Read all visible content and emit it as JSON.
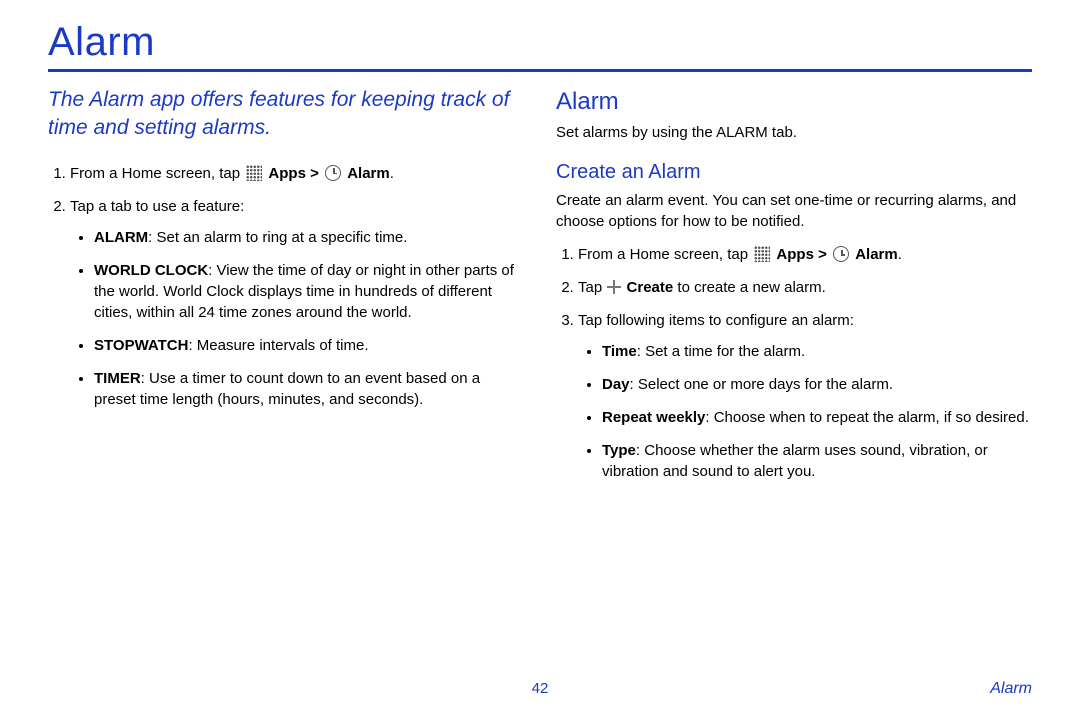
{
  "title": "Alarm",
  "intro": "The Alarm app offers features for keeping track of time and setting alarms.",
  "left": {
    "step1_pre": "From a Home screen, tap ",
    "step1_apps": "Apps > ",
    "step1_alarm": "Alarm",
    "step1_post": ".",
    "step2": "Tap a tab to use a feature:",
    "bullets": {
      "alarm_label": "ALARM",
      "alarm_text": ": Set an alarm to ring at a specific time.",
      "world_label": "WORLD CLOCK",
      "world_text": ": View the time of day or night in other parts of the world. World Clock displays time in hundreds of different cities, within all 24 time zones around the world.",
      "stopwatch_label": "STOPWATCH",
      "stopwatch_text": ": Measure intervals of time.",
      "timer_label": "TIMER",
      "timer_text": ": Use a timer to count down to an event based on a preset time length (hours, minutes, and seconds)."
    }
  },
  "right": {
    "h2": "Alarm",
    "p1": "Set alarms by using the ALARM tab.",
    "h3": "Create an Alarm",
    "p2": "Create an alarm event. You can set one-time or recurring alarms, and choose options for how to be notified.",
    "step1_pre": "From a Home screen, tap ",
    "step1_apps": "Apps > ",
    "step1_alarm": "Alarm",
    "step1_post": ".",
    "step2_pre": "Tap ",
    "step2_create": "Create",
    "step2_post": " to create a new alarm.",
    "step3": "Tap following items to configure an alarm:",
    "bullets": {
      "time_label": "Time",
      "time_text": ": Set a time for the alarm.",
      "day_label": "Day",
      "day_text": ": Select one or more days for the alarm.",
      "repeat_label": "Repeat weekly",
      "repeat_text": ": Choose when to repeat the alarm, if so desired.",
      "type_label": "Type",
      "type_text": ": Choose whether the alarm uses sound, vibration, or vibration and sound to alert you."
    }
  },
  "footer": {
    "page": "42",
    "label": "Alarm"
  }
}
